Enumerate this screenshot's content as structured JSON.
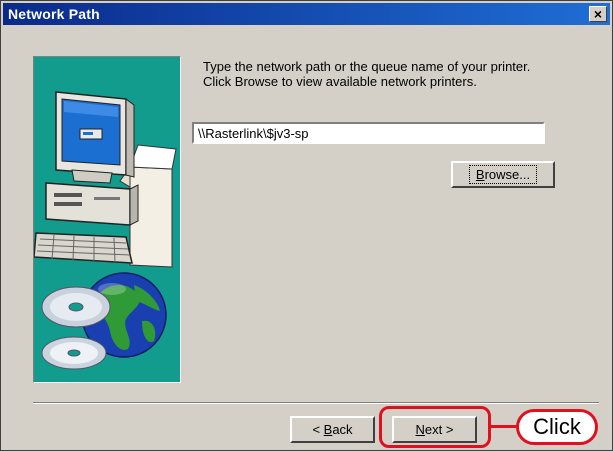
{
  "window": {
    "title": "Network Path",
    "close_glyph": "×"
  },
  "content": {
    "instructions": [
      "Type the network path or the queue name of your printer.",
      "Click Browse to view available network printers."
    ],
    "path_value": "\\\\Rasterlink\\$jv3-sp"
  },
  "buttons": {
    "browse": {
      "label": "Browse...",
      "mnemonic": "B",
      "rest": "rowse..."
    },
    "back": {
      "label": "< Back",
      "prefix": "< ",
      "mnemonic": "B",
      "rest": "ack"
    },
    "next": {
      "label": "Next >",
      "mnemonic": "N",
      "rest": "ext >"
    }
  },
  "annotation": {
    "callout_label": "Click",
    "color": "#e0101e"
  },
  "colors": {
    "titlebar_start": "#0a2a8a",
    "titlebar_end": "#1f6ed6",
    "art_background": "#129c8e",
    "dialog": "#d4d0c8"
  },
  "icons": [
    "close-icon",
    "computer-illustration",
    "globe-cd-illustration"
  ]
}
